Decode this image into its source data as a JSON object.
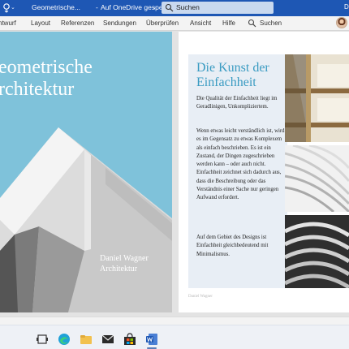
{
  "titlebar": {
    "doc_title": "Geometrische...",
    "separator": "-",
    "doc_status": "Auf OneDrive gespeichert",
    "caret": "⌄",
    "share_chevron": "⌄",
    "search_placeholder": "Suchen",
    "user_initial": "D",
    "color": "#1e57b4"
  },
  "ribbon": {
    "tabs": [
      "ntwurf",
      "Layout",
      "Referenzen",
      "Sendungen",
      "Überprüfen",
      "Ansicht",
      "Hilfe"
    ],
    "search_label": "Suchen"
  },
  "cover": {
    "title_line1": "eometrische",
    "title_line2": "rchitektur",
    "author_line1": "Daniel Wagner",
    "author_line2": "Architektur",
    "sky_color": "#7fc2da"
  },
  "article": {
    "title_line1": "Die Kunst der",
    "title_line2": "Einfachheit",
    "paragraph1": "Die Qualität der Einfachheit liegt im Geradlinigen, Unkompliziertem.",
    "paragraph2": "Wenn etwas leicht verständlich ist, wird es im Gegensatz zu etwas Komplexem als einfach beschrieben. Es ist ein Zustand, der Dingen zugeschrieben werden kann – oder auch nicht. Einfachheit zeichnet sich dadurch aus, dass die Beschreibung oder das Verständnis einer Sache nur geringen Aufwand erfordert.",
    "paragraph3": "Auf dem Gebiet des Designs ist Einfachheit gleichbedeutend mit Minimalismus.",
    "footer": "Daniel Wagner",
    "accent_color": "#3a9bc2"
  },
  "taskbar": {
    "icons": [
      "task-view-icon",
      "edge-icon",
      "explorer-icon",
      "mail-icon",
      "store-icon",
      "word-icon"
    ]
  }
}
